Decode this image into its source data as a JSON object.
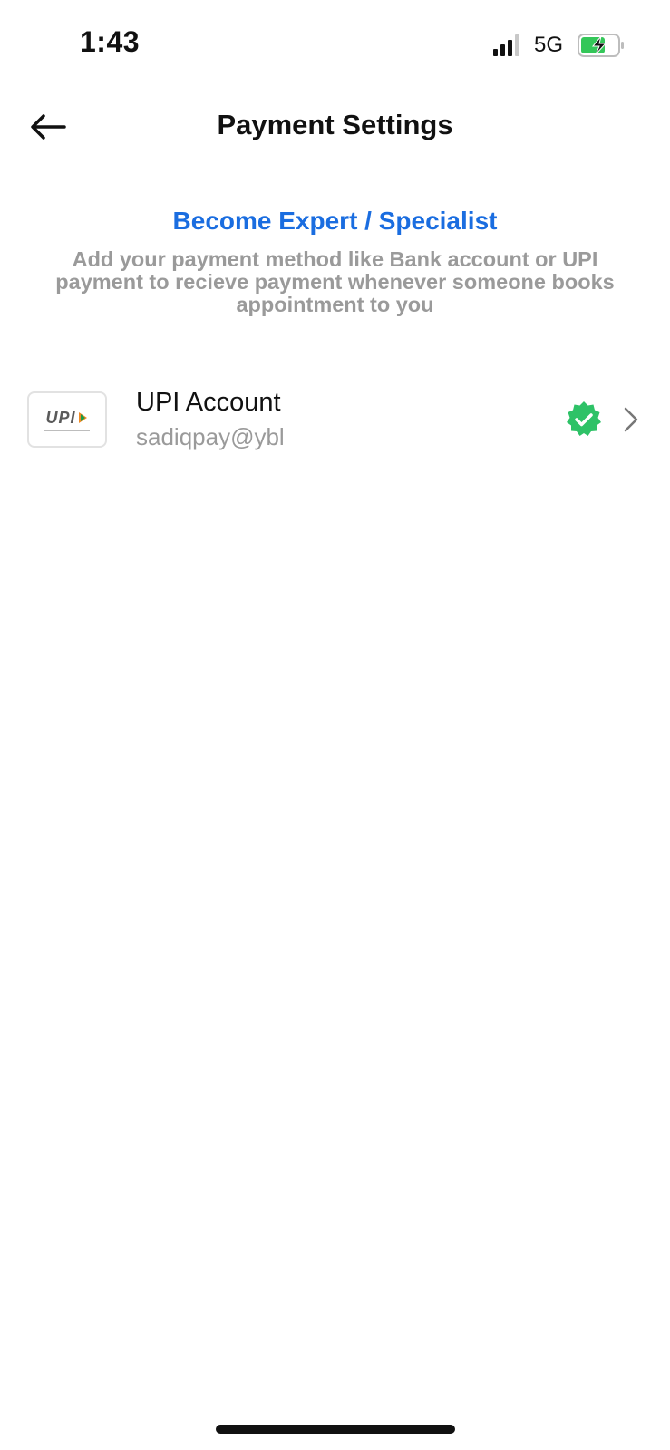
{
  "status_bar": {
    "time": "1:43",
    "network": "5G",
    "battery_color": "#34c759"
  },
  "header": {
    "title": "Payment Settings",
    "back_icon": "arrow-left-icon"
  },
  "intro": {
    "heading": "Become Expert / Specialist",
    "heading_color": "#1a6de0",
    "description": "Add your payment method like Bank account or UPI payment to recieve payment whenever someone books appointment to you"
  },
  "accounts": [
    {
      "logo_text": "UPI",
      "title": "UPI Account",
      "id": "sadiqpay@ybl",
      "status_icon": "verified-badge-icon",
      "status_color": "#2ec267",
      "nav_icon": "chevron-right-icon"
    }
  ]
}
